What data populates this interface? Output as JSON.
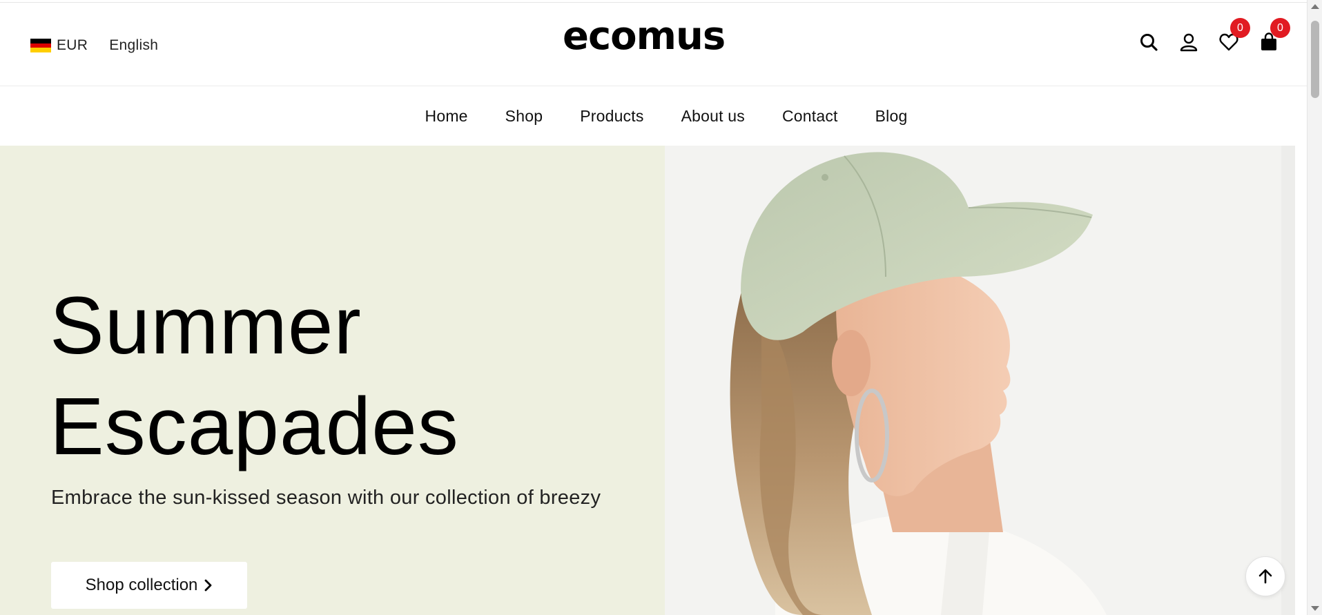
{
  "header": {
    "currency": "EUR",
    "language": "English",
    "logo_text": "ecomus",
    "wishlist_count": "0",
    "cart_count": "0",
    "badge_color": "#e11b22",
    "icons": [
      "search-icon",
      "user-icon",
      "heart-icon",
      "bag-icon"
    ]
  },
  "nav": {
    "items": [
      {
        "label": "Home"
      },
      {
        "label": "Shop"
      },
      {
        "label": "Products"
      },
      {
        "label": "About us"
      },
      {
        "label": "Contact"
      },
      {
        "label": "Blog"
      }
    ]
  },
  "hero": {
    "title_line1": "Summer",
    "title_line2": "Escapades",
    "subtitle": "Embrace the sun-kissed season with our collection of breezy",
    "cta_label": "Shop collection",
    "bg_color": "#eef0e0",
    "image_bg": "#f3f3f1"
  },
  "flag": {
    "colors": [
      "#000000",
      "#dd0000",
      "#ffce00"
    ]
  }
}
